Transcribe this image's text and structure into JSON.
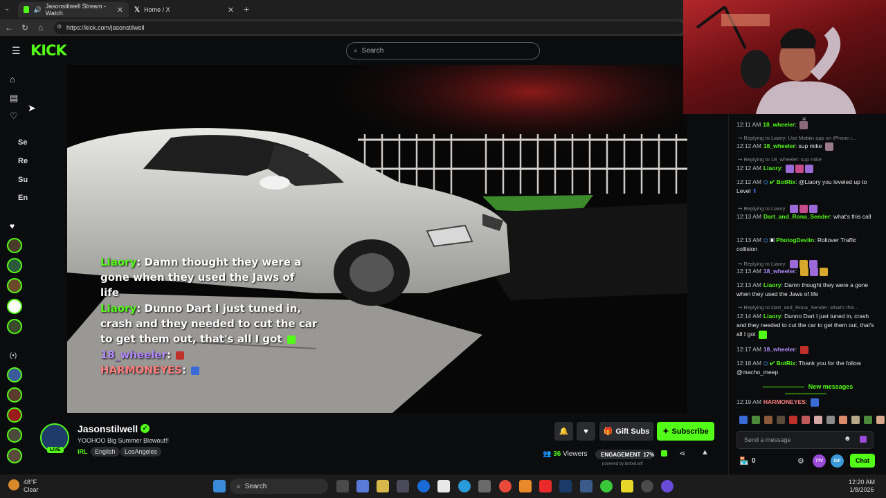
{
  "browser": {
    "tabs": [
      {
        "title": "Jasonstilwell Stream - Watch",
        "active": true
      },
      {
        "title": "Home / X",
        "active": false
      }
    ],
    "url": "https://kick.com/jasonstilwell"
  },
  "header": {
    "logo": "KICK",
    "search_placeholder": "Search"
  },
  "sidebar": {
    "labels": [
      "Se",
      "Re",
      "Su",
      "En"
    ]
  },
  "video_overlay": [
    {
      "user": "Liaory",
      "text": "Damn thought they were a"
    },
    {
      "user": "",
      "text": "gone when they used the Jaws of"
    },
    {
      "user": "",
      "text": "life"
    },
    {
      "user": "Liaory",
      "text": "Dunno Dart I just tuned in,"
    },
    {
      "user": "",
      "text": "crash and they needed to cut the car"
    },
    {
      "user": "",
      "text": "to get them out, that's all I got"
    },
    {
      "user": "18_wheeler",
      "text": ""
    },
    {
      "user": "HARMONEYES",
      "text": ""
    }
  ],
  "channel": {
    "name": "Jasonstilwell",
    "live_badge": "LIVE",
    "title": "YOOHOO Big Summer Blowout!!",
    "category": "IRL",
    "tags": [
      "English",
      "LosAngeles"
    ],
    "viewers_count": "36",
    "viewers_label": "Viewers",
    "engagement_label": "ENGAGEMENT",
    "engagement_value": "17%",
    "powered_by": "powered by botted.wtf",
    "gift_label": "Gift Subs",
    "subscribe_label": "Subscribe"
  },
  "chat": {
    "messages": [
      {
        "time": "12:11 AM",
        "user": "18_wheeler",
        "color": "green",
        "text": "",
        "reply": ""
      },
      {
        "time": "12:12 AM",
        "user": "18_wheeler",
        "color": "green",
        "text": "sup mike",
        "reply": "Replying to Liaory: Use Mobiin app on iPhone i..."
      },
      {
        "time": "12:12 AM",
        "user": "Liaory",
        "color": "green",
        "text": "",
        "reply": "Replying to 18_wheeler: sup mike"
      },
      {
        "time": "12:12 AM",
        "user": "BotRix",
        "color": "green",
        "text": "@Liaory you leveled up to Level",
        "reply": ""
      },
      {
        "time": "12:13 AM",
        "user": "Dart_and_Rona_Sender",
        "color": "green",
        "text": "what's this call",
        "reply": "Replying to Liaory:"
      },
      {
        "time": "12:13 AM",
        "user": "PhotogDevlin",
        "color": "green",
        "text": "Rollover Traffic collision",
        "reply": ""
      },
      {
        "time": "12:13 AM",
        "user": "18_wheeler",
        "color": "purple",
        "text": "",
        "reply": "Replying to Liaory:"
      },
      {
        "time": "12:13 AM",
        "user": "Liaory",
        "color": "green",
        "text": "Damn thought they were a gone when they used the Jaws of life",
        "reply": ""
      },
      {
        "time": "12:14 AM",
        "user": "Liaory",
        "color": "green",
        "text": "Dunno Dart I just tuned in, crash and they needed to cut the car to get them out, that's all I got",
        "reply": "Replying to Dart_and_Rona_Sender: what's this..."
      },
      {
        "time": "12:17 AM",
        "user": "18_wheeler",
        "color": "purple",
        "text": "",
        "reply": ""
      },
      {
        "time": "12:18 AM",
        "user": "BotRix",
        "color": "green",
        "text": "Thank you for the follow @macho_meep",
        "reply": ""
      },
      {
        "time": "12:19 AM",
        "user": "HARMONEYES",
        "color": "red",
        "text": "",
        "reply": ""
      }
    ],
    "new_messages_label": "New messages",
    "input_placeholder": "Send a message",
    "points": "0",
    "chat_button": "Chat"
  },
  "taskbar": {
    "weather_temp": "48°F",
    "weather_desc": "Clear",
    "search_label": "Search",
    "time": "12:20 AM",
    "date": "1/8/2026"
  },
  "colors": {
    "accent": "#53fc18",
    "background": "#0b0c0e",
    "purple_name": "#b48cff",
    "red_name": "#ff7f7f"
  }
}
